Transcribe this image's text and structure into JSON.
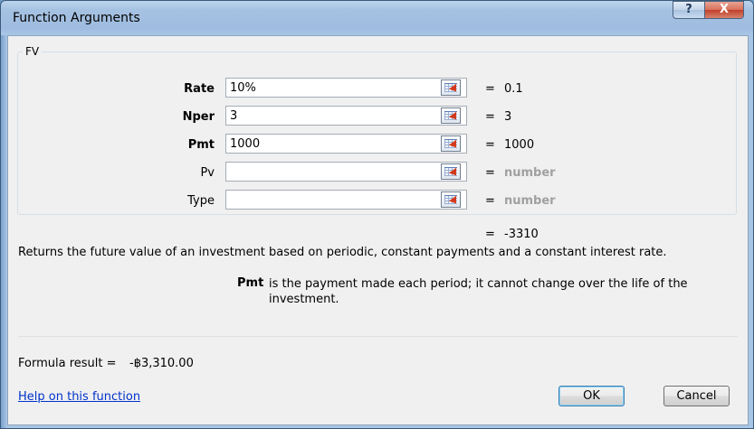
{
  "window": {
    "title": "Function Arguments",
    "help_glyph": "?",
    "close_glyph": "X"
  },
  "group": {
    "label": "FV"
  },
  "arguments": [
    {
      "label": "Rate",
      "value": "10%",
      "eval": "0.1",
      "muted": false
    },
    {
      "label": "Nper",
      "value": "3",
      "eval": "3",
      "muted": false
    },
    {
      "label": "Pmt",
      "value": "1000",
      "eval": "1000",
      "muted": false
    },
    {
      "label": "Pv",
      "value": "",
      "eval": "number",
      "muted": true
    },
    {
      "label": "Type",
      "value": "",
      "eval": "number",
      "muted": true
    }
  ],
  "equals": "=",
  "result_value": "-3310",
  "description": "Returns the future value of an investment based on periodic, constant payments and a constant interest rate.",
  "arg_help": {
    "name": "Pmt",
    "text": "is the payment made each period; it cannot change over the life of the investment."
  },
  "formula": {
    "label": "Formula result =",
    "value": "-฿3,310.00"
  },
  "help_link": "Help on this function",
  "buttons": {
    "ok": "OK",
    "cancel": "Cancel"
  },
  "icons": {
    "ref_button": "collapse-dialog-icon"
  }
}
